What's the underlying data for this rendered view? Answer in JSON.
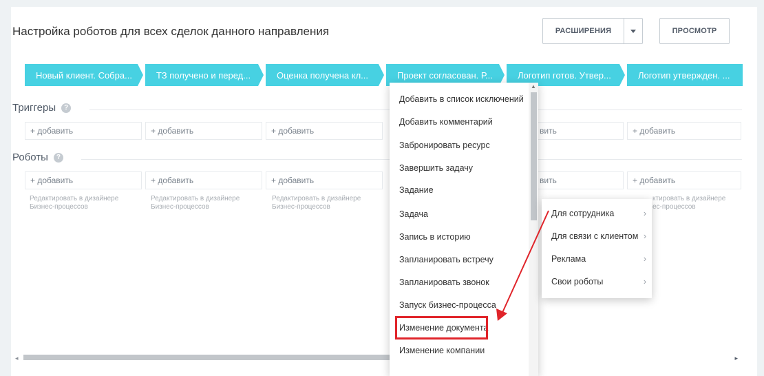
{
  "header": {
    "title": "Настройка роботов для всех сделок данного направления",
    "extensions_label": "РАСШИРЕНИЯ",
    "view_label": "ПРОСМОТР"
  },
  "stages": [
    "Новый клиент. Собра...",
    "ТЗ получено и перед...",
    "Оценка получена кл...",
    "Проект согласован. Р...",
    "Логотип готов. Утвер...",
    "Логотип утвержден. ..."
  ],
  "triggers": {
    "label": "Триггеры",
    "add_label": "+ добавить"
  },
  "robots": {
    "label": "Роботы",
    "add_label": "+ добавить",
    "designer_note_line1": "Редактировать в дизайнере",
    "designer_note_line2": "Бизнес-процессов"
  },
  "partial_text": {
    "add_fragment": "вить",
    "note_fragment_line1": "ктировать в дизайнере",
    "note_fragment_line2": "ес-процессов"
  },
  "help_icon_glyph": "?",
  "robot_menu": {
    "items": [
      "Добавить в список исключений",
      "Добавить комментарий",
      "Забронировать ресурс",
      "Завершить задачу",
      "Задание",
      "Задача",
      "Запись в историю",
      "Запланировать встречу",
      "Запланировать звонок",
      "Запуск бизнес-процесса",
      "Изменение документа",
      "Изменение компании"
    ],
    "highlighted": "Изменение документа"
  },
  "category_submenu": {
    "items": [
      "Для сотрудника",
      "Для связи с клиентом",
      "Реклама",
      "Свои роботы"
    ]
  },
  "colors": {
    "stage": "#47d1e2",
    "highlight_box": "#e0242a",
    "arrow": "#e0242a"
  }
}
